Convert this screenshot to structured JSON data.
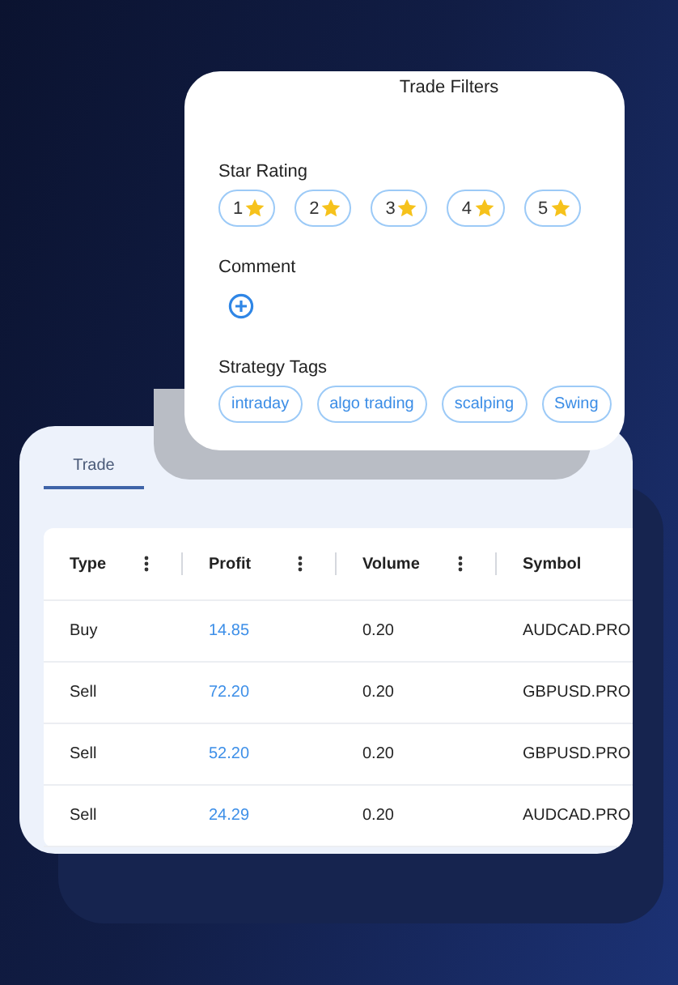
{
  "filters": {
    "title": "Trade Filters",
    "star_rating": {
      "label": "Star Rating",
      "options": [
        "1",
        "2",
        "3",
        "4",
        "5"
      ]
    },
    "comment": {
      "label": "Comment"
    },
    "strategy_tags": {
      "label": "Strategy Tags",
      "tags": [
        "intraday",
        "algo trading",
        "scalping",
        "Swing"
      ]
    }
  },
  "trades": {
    "tabs": [
      {
        "label": "Trade",
        "selected": true
      }
    ],
    "table": {
      "columns": [
        "Type",
        "Profit",
        "Volume",
        "Symbol"
      ],
      "rows": [
        [
          "Buy",
          "14.85",
          "0.20",
          "AUDCAD.PRO"
        ],
        [
          "Sell",
          "72.20",
          "0.20",
          "GBPUSD.PRO"
        ],
        [
          "Sell",
          "52.20",
          "0.20",
          "GBPUSD.PRO"
        ],
        [
          "Sell",
          "24.29",
          "0.20",
          "AUDCAD.PRO"
        ]
      ]
    }
  }
}
